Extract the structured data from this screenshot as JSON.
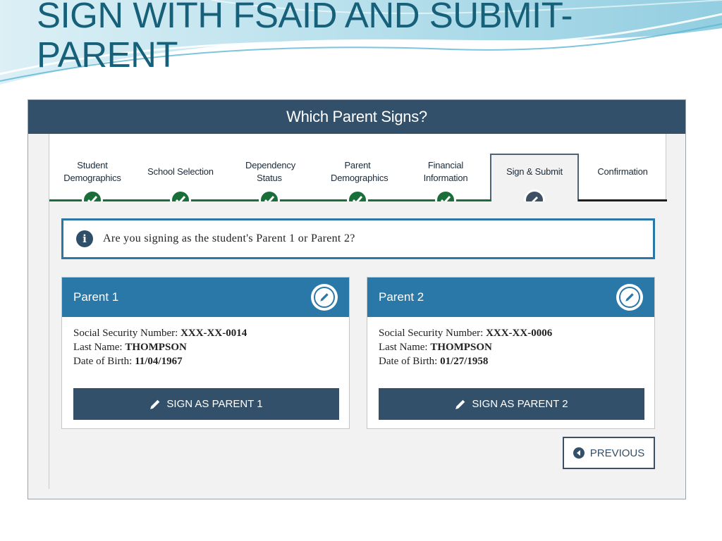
{
  "slide": {
    "title": "SIGN WITH FSAID AND SUBMIT- PARENT"
  },
  "screen": {
    "header_title": "Which Parent Signs?",
    "steps": [
      {
        "label": "Student Demographics",
        "status": "complete"
      },
      {
        "label": "School Selection",
        "status": "complete"
      },
      {
        "label": "Dependency Status",
        "status": "complete"
      },
      {
        "label": "Parent Demographics",
        "status": "complete"
      },
      {
        "label": "Financial Information",
        "status": "complete"
      },
      {
        "label": "Sign & Submit",
        "status": "current"
      },
      {
        "label": "Confirmation",
        "status": "upcoming"
      }
    ],
    "alert": {
      "icon": "info-icon",
      "text": "Are you signing as the student's Parent 1 or Parent 2?"
    },
    "parents": [
      {
        "title": "Parent 1",
        "ssn_label": "Social Security Number:",
        "ssn": "XXX-XX-0014",
        "last_name_label": "Last Name:",
        "last_name": "THOMPSON",
        "dob_label": "Date of Birth:",
        "dob": "11/04/1967",
        "button_label": "SIGN AS PARENT 1"
      },
      {
        "title": "Parent 2",
        "ssn_label": "Social Security Number:",
        "ssn": "XXX-XX-0006",
        "last_name_label": "Last Name:",
        "last_name": "THOMPSON",
        "dob_label": "Date of Birth:",
        "dob": "01/27/1958",
        "button_label": "SIGN AS PARENT 2"
      }
    ],
    "previous_label": "PREVIOUS"
  },
  "colors": {
    "title": "#17607a",
    "header": "#33506a",
    "step_complete": "#1a6e3a",
    "card_header": "#2a78a8",
    "button": "#33506a"
  }
}
